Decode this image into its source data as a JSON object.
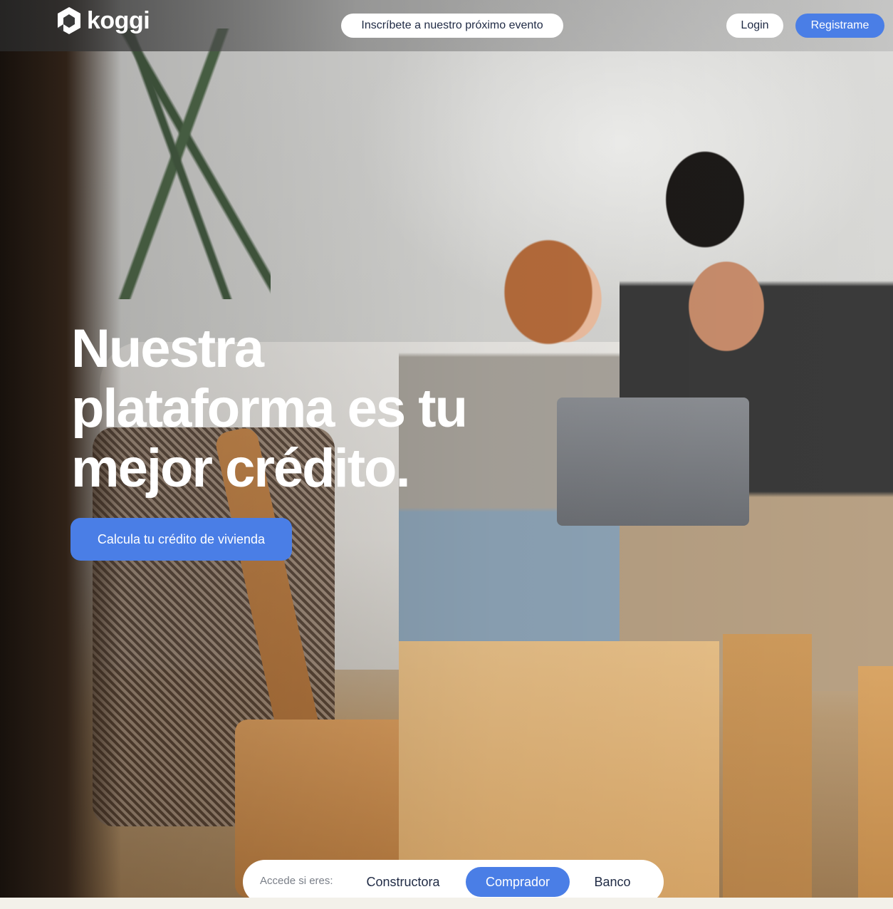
{
  "header": {
    "logo_text": "koggi",
    "event_button": "Inscríbete a nuestro próximo evento",
    "login_button": "Login",
    "register_button": "Registrame"
  },
  "hero": {
    "headline": "Nuestra plataforma es tu mejor crédito.",
    "cta_button": "Calcula tu crédito de vivienda"
  },
  "role_selector": {
    "label": "Accede si eres:",
    "options": [
      "Constructora",
      "Comprador",
      "Banco"
    ],
    "selected": "Comprador"
  },
  "colors": {
    "accent": "#4a7ee6",
    "text_dark": "#1f2a44",
    "white": "#ffffff"
  },
  "icons": {
    "logo": "koggi-hexagon-logo-icon"
  }
}
